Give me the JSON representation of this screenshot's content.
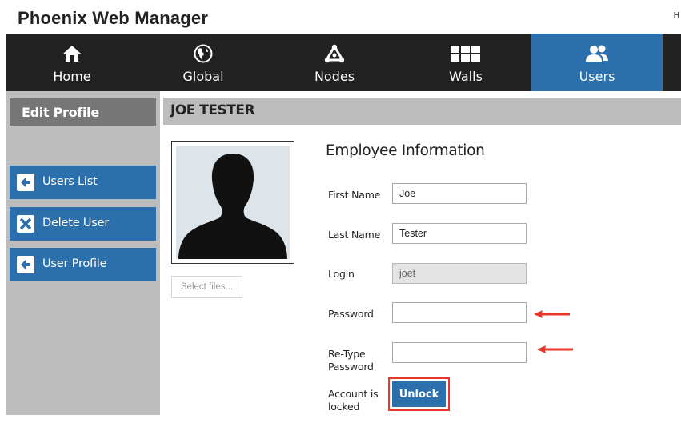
{
  "app": {
    "title": "Phoenix Web Manager",
    "header_edge": "H"
  },
  "nav": {
    "items": [
      {
        "label": "Home",
        "icon": "home-icon"
      },
      {
        "label": "Global",
        "icon": "globe-icon"
      },
      {
        "label": "Nodes",
        "icon": "nodes-icon"
      },
      {
        "label": "Walls",
        "icon": "walls-grid-icon"
      },
      {
        "label": "Users",
        "icon": "users-icon",
        "active": true
      }
    ],
    "active_color": "#2c6fad",
    "bg_color": "#222222"
  },
  "sidebar": {
    "title": "Edit Profile",
    "buttons": [
      {
        "label": "Users List",
        "icon": "arrow-left-icon"
      },
      {
        "label": "Delete User",
        "icon": "delete-x-icon"
      },
      {
        "label": "User Profile",
        "icon": "arrow-left-icon"
      }
    ]
  },
  "profile": {
    "user_name": "JOE TESTER",
    "select_files_label": "Select files...",
    "section_title": "Employee Information",
    "fields": {
      "first_name": {
        "label": "First Name",
        "value": "Joe"
      },
      "last_name": {
        "label": "Last Name",
        "value": "Tester"
      },
      "login": {
        "label": "Login",
        "value": "joet"
      },
      "password": {
        "label": "Password",
        "value": ""
      },
      "retype_password": {
        "label_line1": "Re-Type",
        "label_line2": "Password",
        "value": ""
      }
    },
    "account_status": {
      "label_line1": "Account is",
      "label_line2": "locked"
    },
    "unlock_label": "Unlock"
  },
  "colors": {
    "accent": "#2c6fad",
    "annotation": "#e8372a",
    "sidebar_bg": "#bdbdbd"
  }
}
